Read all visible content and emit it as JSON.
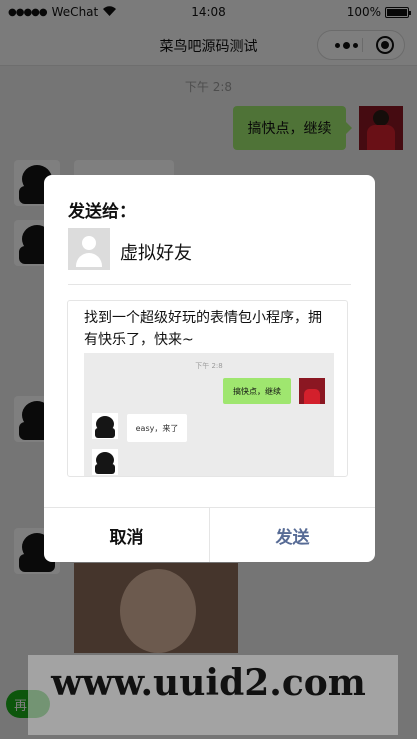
{
  "status_bar": {
    "carrier": "WeChat",
    "time": "14:08",
    "battery": "100%"
  },
  "nav": {
    "title": "菜鸟吧源码测试"
  },
  "chat": {
    "time": "下午 2:8",
    "my_message": "搞快点，继续",
    "bottom_button": "再"
  },
  "dialog": {
    "title": "发送给：",
    "friend_name": "虚拟好友",
    "share_text": "找到一个超级好玩的表情包小程序，拥有快乐了，快来~",
    "preview": {
      "time": "下午 2:8",
      "my_message": "搞快点，继续",
      "bot_message": "easy，来了"
    },
    "cancel_label": "取消",
    "send_label": "发送"
  },
  "watermark": "www.uuid2.com",
  "colors": {
    "accent": "#576b95",
    "bubble_green": "#9fe66f",
    "wechat_green": "#1aad19"
  }
}
